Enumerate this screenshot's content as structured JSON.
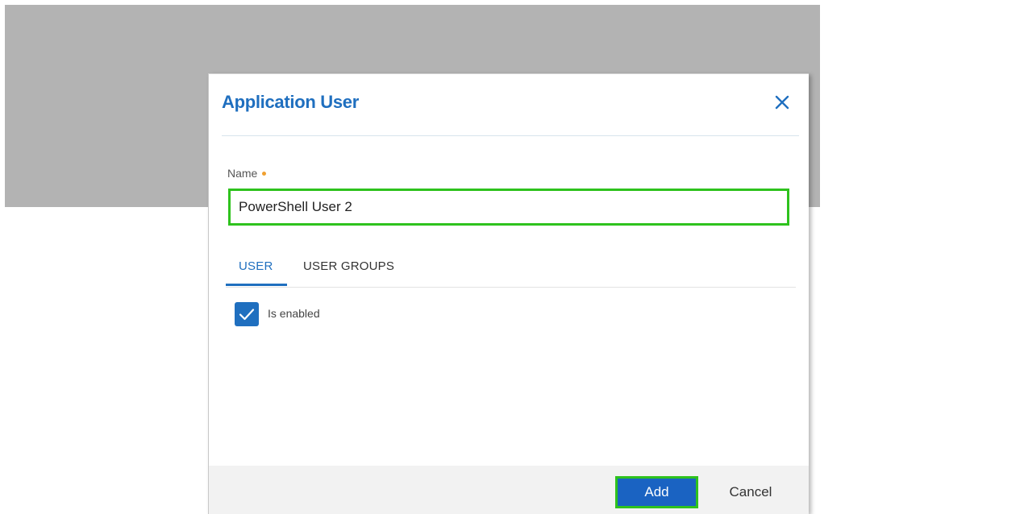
{
  "dialog": {
    "title": "Application User",
    "close_icon": "close-icon",
    "name_field": {
      "label": "Name",
      "required": true,
      "value": "PowerShell User 2"
    },
    "tabs": [
      {
        "label": "USER",
        "active": true
      },
      {
        "label": "USER GROUPS",
        "active": false
      }
    ],
    "enabled_checkbox": {
      "label": "Is enabled",
      "checked": true,
      "icon": "checkmark-icon"
    },
    "footer": {
      "add_label": "Add",
      "cancel_label": "Cancel"
    }
  },
  "colors": {
    "accent": "#1f6fbf",
    "primary_button": "#1a63c2",
    "highlight_outline": "#2ec21d",
    "required_marker": "#f0a030",
    "backdrop": "#b3b3b3",
    "footer_background": "#f2f2f2"
  }
}
